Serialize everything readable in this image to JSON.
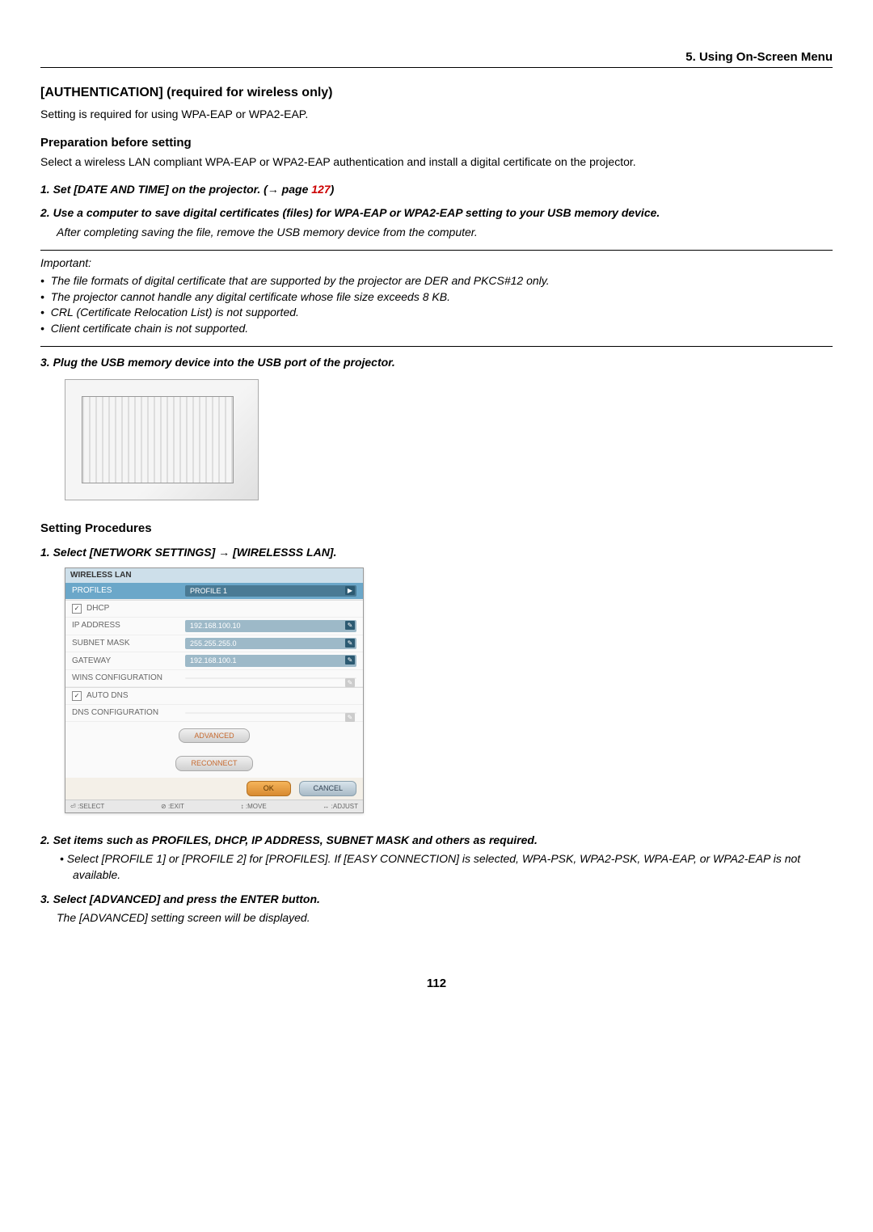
{
  "header": {
    "chapter": "5. Using On-Screen Menu"
  },
  "auth": {
    "title": "[AUTHENTICATION] (required for wireless only)",
    "desc": "Setting is required for using WPA-EAP or WPA2-EAP."
  },
  "prep": {
    "heading": "Preparation before setting",
    "desc": "Select a wireless LAN compliant WPA-EAP or WPA2-EAP authentication and install a digital certificate on the projector."
  },
  "steps_a": {
    "s1_pre": "1.  Set [DATE AND TIME] on the projector. (→ page ",
    "s1_page": "127",
    "s1_post": ")",
    "s2": "2.  Use a computer to save digital certificates (files) for WPA-EAP or WPA2-EAP setting to your USB memory device.",
    "s2_note": "After completing saving the file, remove the USB memory device from the computer."
  },
  "important": {
    "title": "Important:",
    "b1": "The file formats of digital certificate that are supported by the projector are DER and PKCS#12 only.",
    "b2": "The projector cannot handle any digital certificate whose file size exceeds 8 KB.",
    "b3": "CRL (Certificate Relocation List) is not supported.",
    "b4": "Client certificate chain is not supported."
  },
  "step3": "3.  Plug the USB memory device into the USB port of the projector.",
  "proc": {
    "heading": "Setting Procedures",
    "s1": "1.  Select [NETWORK SETTINGS] → [WIRELESSS LAN]."
  },
  "menu": {
    "title": "WIRELESS LAN",
    "profiles_label": "PROFILES",
    "profiles_value": "PROFILE 1",
    "dhcp": "DHCP",
    "ip_label": "IP ADDRESS",
    "ip_value": "192.168.100.10",
    "subnet_label": "SUBNET MASK",
    "subnet_value": "255.255.255.0",
    "gateway_label": "GATEWAY",
    "gateway_value": "192.168.100.1",
    "wins_label": "WINS CONFIGURATION",
    "wins_value": "",
    "autodns": "AUTO DNS",
    "dns_label": "DNS CONFIGURATION",
    "dns_value": "",
    "advanced": "ADVANCED",
    "reconnect": "RECONNECT",
    "ok": "OK",
    "cancel": "CANCEL",
    "footer_select": ":SELECT",
    "footer_exit": ":EXIT",
    "footer_move1": ":MOVE",
    "footer_move2": ":ADJUST"
  },
  "steps_b": {
    "s2": "2.  Set items such as PROFILES, DHCP, IP ADDRESS, SUBNET MASK and others as required.",
    "s2_bullet": "Select [PROFILE 1] or [PROFILE 2] for [PROFILES]. If [EASY CONNECTION] is selected, WPA-PSK, WPA2-PSK, WPA-EAP, or WPA2-EAP is not available.",
    "s3": "3.  Select [ADVANCED] and press the ENTER button.",
    "s3_note": "The [ADVANCED] setting screen will be displayed."
  },
  "page_number": "112"
}
